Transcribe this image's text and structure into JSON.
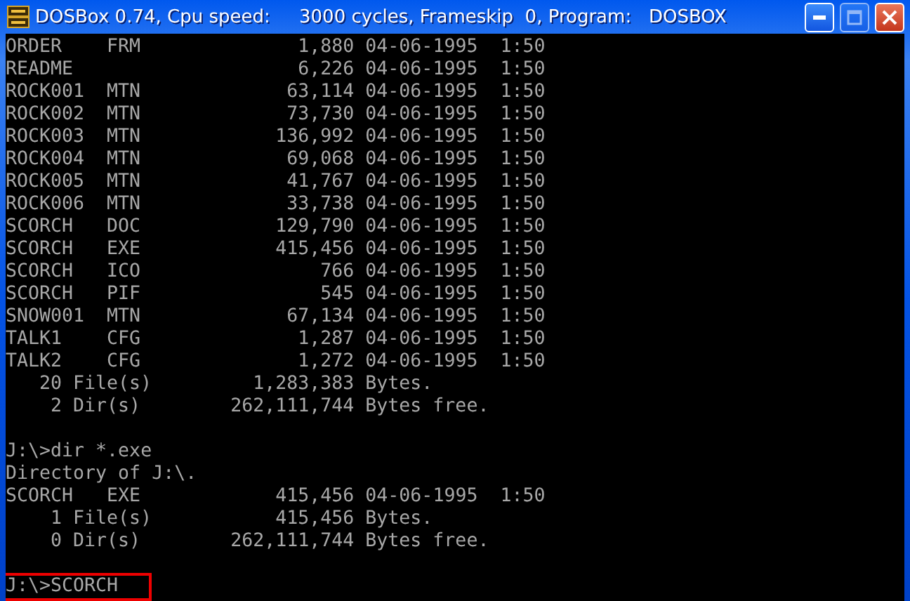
{
  "window": {
    "title": "DOSBox 0.74, Cpu speed:     3000 cycles, Frameskip  0, Program:   DOSBOX",
    "maximize_disabled": true
  },
  "listing_1": {
    "rows": [
      {
        "name": "ORDER",
        "ext": "FRM",
        "size": "1,880",
        "date": "04-06-1995",
        "time": "1:50"
      },
      {
        "name": "README",
        "ext": "",
        "size": "6,226",
        "date": "04-06-1995",
        "time": "1:50"
      },
      {
        "name": "ROCK001",
        "ext": "MTN",
        "size": "63,114",
        "date": "04-06-1995",
        "time": "1:50"
      },
      {
        "name": "ROCK002",
        "ext": "MTN",
        "size": "73,730",
        "date": "04-06-1995",
        "time": "1:50"
      },
      {
        "name": "ROCK003",
        "ext": "MTN",
        "size": "136,992",
        "date": "04-06-1995",
        "time": "1:50"
      },
      {
        "name": "ROCK004",
        "ext": "MTN",
        "size": "69,068",
        "date": "04-06-1995",
        "time": "1:50"
      },
      {
        "name": "ROCK005",
        "ext": "MTN",
        "size": "41,767",
        "date": "04-06-1995",
        "time": "1:50"
      },
      {
        "name": "ROCK006",
        "ext": "MTN",
        "size": "33,738",
        "date": "04-06-1995",
        "time": "1:50"
      },
      {
        "name": "SCORCH",
        "ext": "DOC",
        "size": "129,790",
        "date": "04-06-1995",
        "time": "1:50"
      },
      {
        "name": "SCORCH",
        "ext": "EXE",
        "size": "415,456",
        "date": "04-06-1995",
        "time": "1:50"
      },
      {
        "name": "SCORCH",
        "ext": "ICO",
        "size": "766",
        "date": "04-06-1995",
        "time": "1:50"
      },
      {
        "name": "SCORCH",
        "ext": "PIF",
        "size": "545",
        "date": "04-06-1995",
        "time": "1:50"
      },
      {
        "name": "SNOW001",
        "ext": "MTN",
        "size": "67,134",
        "date": "04-06-1995",
        "time": "1:50"
      },
      {
        "name": "TALK1",
        "ext": "CFG",
        "size": "1,287",
        "date": "04-06-1995",
        "time": "1:50"
      },
      {
        "name": "TALK2",
        "ext": "CFG",
        "size": "1,272",
        "date": "04-06-1995",
        "time": "1:50"
      }
    ],
    "summary": [
      {
        "count": "20",
        "label": "File(s)",
        "amount": "1,283,383",
        "unit": "Bytes."
      },
      {
        "count": "2",
        "label": "Dir(s)",
        "amount": "262,111,744",
        "unit": "Bytes free."
      }
    ]
  },
  "command": "J:\\>dir *.exe",
  "directory_header": "Directory of J:\\.",
  "listing_2": {
    "rows": [
      {
        "name": "SCORCH",
        "ext": "EXE",
        "size": "415,456",
        "date": "04-06-1995",
        "time": "1:50"
      }
    ],
    "summary": [
      {
        "count": "1",
        "label": "File(s)",
        "amount": "415,456",
        "unit": "Bytes."
      },
      {
        "count": "0",
        "label": "Dir(s)",
        "amount": "262,111,744",
        "unit": "Bytes free."
      }
    ]
  },
  "prompt": {
    "text": "J:\\>SCORCH",
    "highlighted": true
  }
}
